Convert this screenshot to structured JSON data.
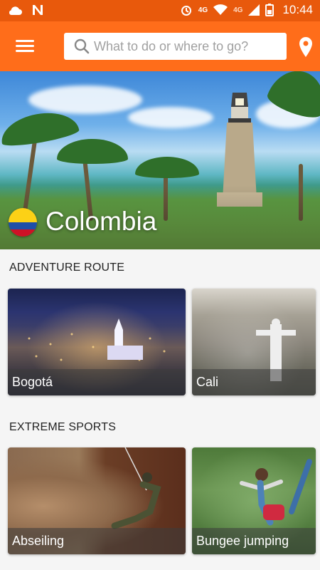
{
  "status_bar": {
    "time": "10:44",
    "network_label": "4G",
    "data_badge": "4G",
    "icons": [
      "cloud-icon",
      "n-notification-icon",
      "alarm-icon",
      "signal-icon",
      "wifi-icon",
      "battery-icon"
    ]
  },
  "app_bar": {
    "menu_icon": "hamburger-menu-icon",
    "search_placeholder": "What to do or where to go?",
    "location_icon": "location-pin-icon",
    "accent_color": "#ff6d1a"
  },
  "hero": {
    "title": "Colombia",
    "flag_colors": [
      "#fcd116",
      "#1f4fa8",
      "#ce1126"
    ]
  },
  "sections": [
    {
      "title": "ADVENTURE ROUTE",
      "cards": [
        {
          "label": "Bogotá"
        },
        {
          "label": "Cali"
        }
      ]
    },
    {
      "title": "EXTREME SPORTS",
      "cards": [
        {
          "label": "Abseiling"
        },
        {
          "label": "Bungee jumping"
        }
      ]
    }
  ]
}
